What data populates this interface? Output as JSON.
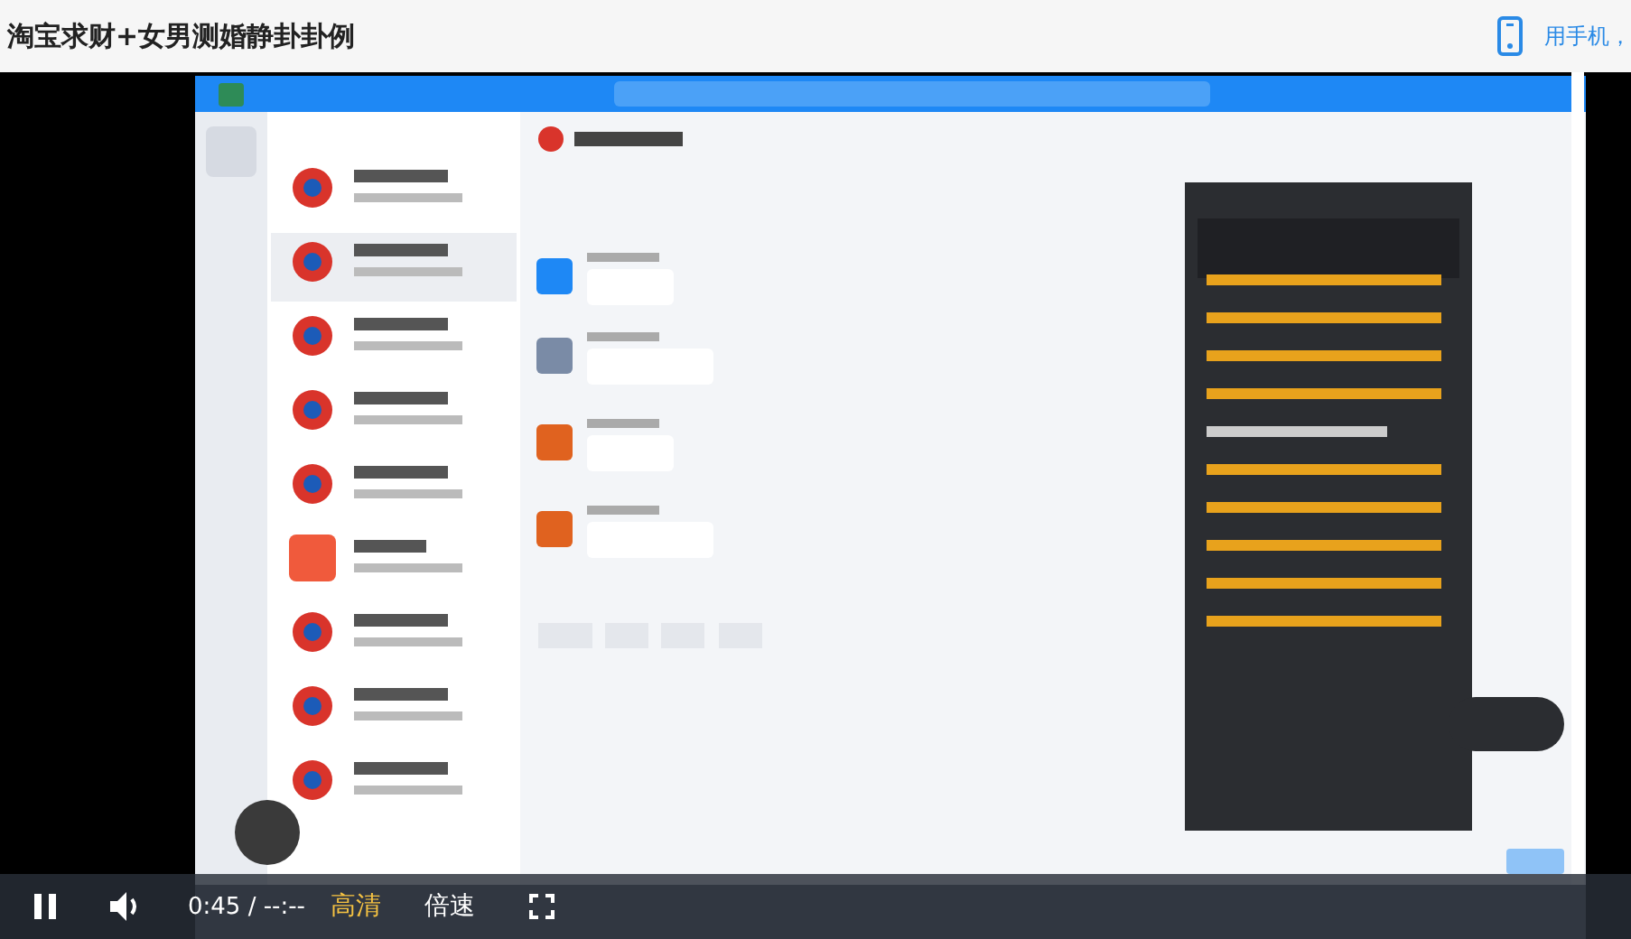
{
  "page": {
    "title": "淘宝求财+女男测婚静卦卦例",
    "mobile_link": "用手机，"
  },
  "player": {
    "playing": true,
    "muted": false,
    "time": "0:45 / --:--",
    "quality": {
      "label": "高清",
      "selected": true
    },
    "speed": "倍速"
  }
}
